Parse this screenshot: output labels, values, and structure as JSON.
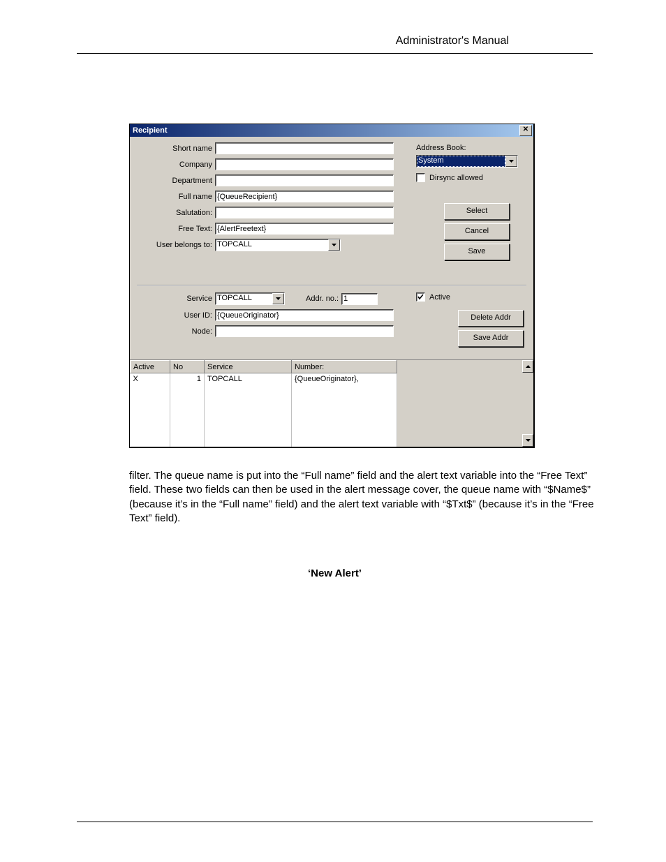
{
  "page": {
    "header": "Administrator's Manual"
  },
  "dialog": {
    "title": "Recipient",
    "labels": {
      "short_name": "Short name",
      "company": "Company",
      "department": "Department",
      "full_name": "Full name",
      "salutation": "Salutation:",
      "free_text": "Free Text:",
      "user_belongs": "User belongs to:",
      "service": "Service",
      "addr_no": "Addr. no.:",
      "user_id": "User ID:",
      "node": "Node:",
      "address_book": "Address Book:",
      "dirsync": "Dirsync allowed",
      "active": "Active"
    },
    "values": {
      "short_name": "",
      "company": "",
      "department": "",
      "full_name": "{QueueRecipient}",
      "salutation": "",
      "free_text": "{AlertFreetext}",
      "user_belongs": "TOPCALL",
      "service": "TOPCALL",
      "addr_no": "1",
      "user_id": "{QueueOriginator}",
      "node": "",
      "address_book": "System",
      "dirsync_checked": false,
      "active_checked": true
    },
    "buttons": {
      "select": "Select",
      "cancel": "Cancel",
      "save": "Save",
      "delete_addr": "Delete Addr",
      "save_addr": "Save Addr"
    },
    "grid": {
      "headers": {
        "active": "Active",
        "no": "No",
        "service": "Service",
        "number": "Number:"
      },
      "rows": [
        {
          "active": "X",
          "no": "1",
          "service": "TOPCALL",
          "number": "{QueueOriginator},"
        }
      ]
    }
  },
  "body": {
    "paragraph": "filter. The queue name is put into the “Full name” field and the alert text variable into the “Free Text” field. These two fields can then be used in the alert message cover, the queue name with “$Name$” (because it’s in the “Full name” field) and the alert text variable with “$Txt$” (because it’s in the “Free Text” field).",
    "subhead": "‘New Alert’"
  }
}
